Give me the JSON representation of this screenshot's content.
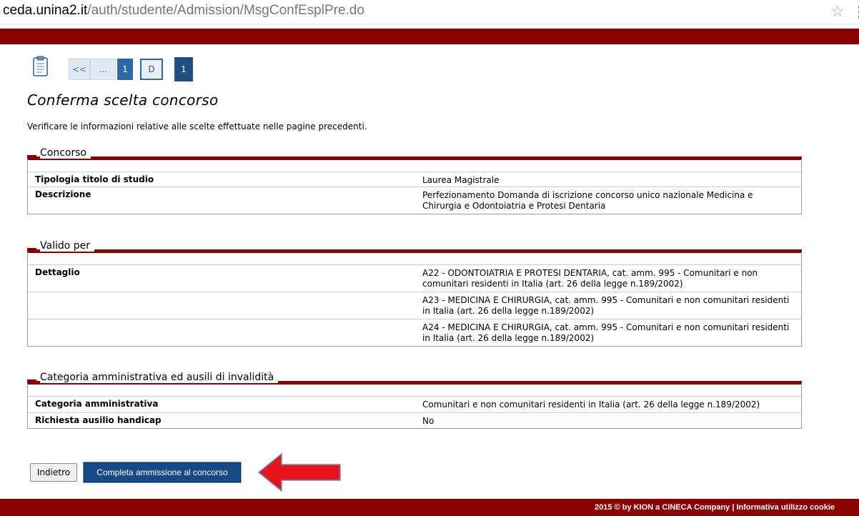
{
  "browser": {
    "url_host": "ceda.unina2.it",
    "url_path": "/auth/studente/Admission/MsgConfEsplPre.do",
    "star_icon": "bookmark-star-icon",
    "menu_icon": "chrome-menu-icon"
  },
  "nav": {
    "icon": "clipboard-icon",
    "steps": {
      "prev": "<<",
      "dots": "...",
      "step1": "1",
      "stepD": "D",
      "step_current": "1"
    }
  },
  "page": {
    "title": "Conferma scelta concorso",
    "intro": "Verificare le informazioni relative alle scelte effettuate nelle pagine precedenti."
  },
  "sections": {
    "concorso": {
      "title": "Concorso",
      "rows": [
        {
          "key": "Tipologia titolo di studio",
          "value": "Laurea Magistrale"
        },
        {
          "key": "Descrizione",
          "value": "Perfezionamento Domanda di iscrizione concorso unico nazionale Medicina e Chirurgia e Odontoiatria e Protesi Dentaria"
        }
      ]
    },
    "valido": {
      "title": "Valido per",
      "rows": [
        {
          "key": "Dettaglio",
          "value": "A22 - ODONTOIATRIA E PROTESI DENTARIA, cat. amm. 995 - Comunitari e non comunitari residenti in Italia (art. 26 della legge n.189/2002)"
        },
        {
          "key": "",
          "value": "A23 - MEDICINA E CHIRURGIA, cat. amm. 995 - Comunitari e non comunitari residenti in Italia (art. 26 della legge n.189/2002)"
        },
        {
          "key": "",
          "value": "A24 - MEDICINA E CHIRURGIA, cat. amm. 995 - Comunitari e non comunitari residenti in Italia (art. 26 della legge n.189/2002)"
        }
      ]
    },
    "categoria": {
      "title": "Categoria amministrativa ed ausili di invalidità",
      "rows": [
        {
          "key": "Categoria amministrativa",
          "value": "Comunitari e non comunitari residenti in Italia (art. 26 della legge n.189/2002)"
        },
        {
          "key": "Richiesta ausilio handicap",
          "value": "No"
        }
      ]
    }
  },
  "actions": {
    "back_label": "Indietro",
    "submit_label": "Completa ammissione al concorso",
    "arrow_icon": "red-arrow-left-icon"
  },
  "footer": {
    "text": "2015 © by KION a CINECA Company | Informativa utilizzo cookie"
  },
  "colors": {
    "brand_red": "#8b0000",
    "button_blue": "#154a86",
    "nav_blue": "#2b6aa8",
    "arrow_red": "#e8141b"
  }
}
